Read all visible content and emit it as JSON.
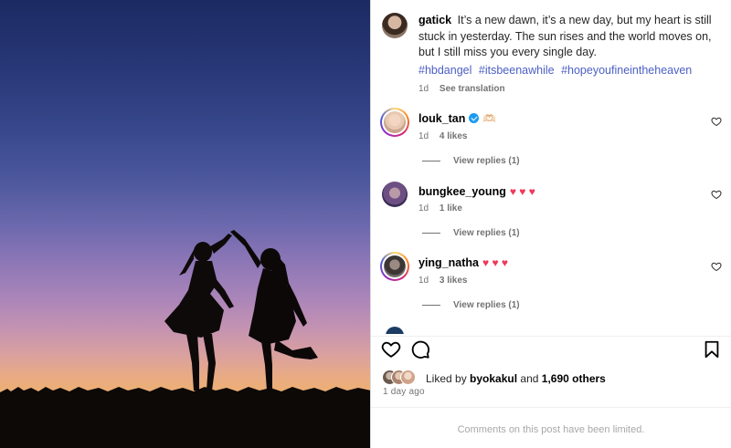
{
  "post": {
    "username": "gatick",
    "caption": "It’s a new dawn, it’s a new day, but my heart is still stuck in yesterday. The sun rises and the world moves on, but I still miss you every single day.",
    "hashtags": [
      "#hbdangel",
      "#itsbeenawhile",
      "#hopeyoufineintheheaven"
    ],
    "age": "1d",
    "see_translation": "See translation"
  },
  "comments": [
    {
      "username": "louk_tan",
      "verified": true,
      "text": "🫶🏻",
      "age": "1d",
      "likes": "4 likes",
      "view_replies": "View replies (1)"
    },
    {
      "username": "bungkee_young",
      "text": "♥ ♥ ♥",
      "age": "1d",
      "likes": "1 like",
      "view_replies": "View replies (1)"
    },
    {
      "username": "ying_natha",
      "text": "♥ ♥ ♥",
      "age": "1d",
      "likes": "3 likes",
      "view_replies": "View replies (1)"
    }
  ],
  "likes": {
    "prefix": "Liked by",
    "user": "byokakul",
    "conjunction": "and",
    "others": "1,690 others"
  },
  "time_ago": "1 day ago",
  "comments_limited": "Comments on this post have been limited.",
  "icons": {
    "like": "heart-outline-icon",
    "comment": "comment-bubble-icon",
    "save": "bookmark-icon",
    "comment_like": "small-heart-icon",
    "verified": "verified-badge-icon"
  },
  "colors": {
    "hashtag": "#4b5fc4",
    "verified": "#1d9bf0",
    "heart_emoji": "#f0385a",
    "muted": "#737373"
  }
}
